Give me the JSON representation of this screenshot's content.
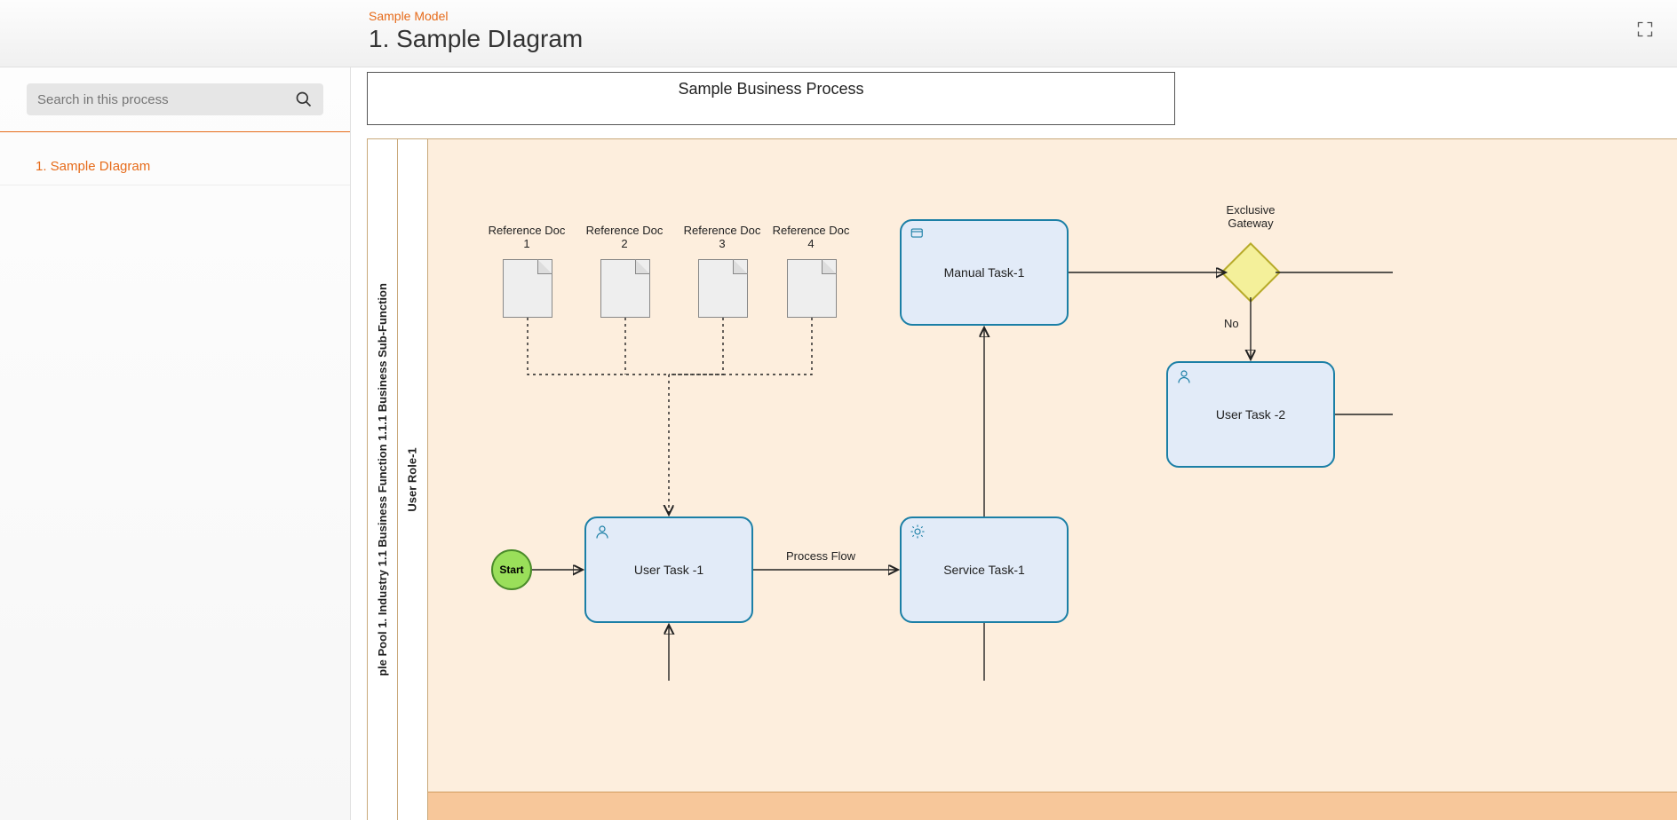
{
  "header": {
    "model_name": "Sample Model",
    "diagram_title": "1. Sample DIagram"
  },
  "sidebar": {
    "search_placeholder": "Search in this process",
    "items": [
      {
        "label": "1. Sample DIagram"
      }
    ]
  },
  "diagram": {
    "pool_header": "Sample Business Process",
    "pool_title": "ple Pool 1. Industry 1.1 Business Function 1.1.1 Business Sub-Function",
    "lane_title": "User Role-1",
    "docs": [
      {
        "label": "Reference Doc 1"
      },
      {
        "label": "Reference Doc 2"
      },
      {
        "label": "Reference Doc 3"
      },
      {
        "label": "Reference Doc 4"
      }
    ],
    "start_label": "Start",
    "tasks": {
      "user_task_1": "User Task -1",
      "service_task_1": "Service Task-1",
      "manual_task_1": "Manual Task-1",
      "user_task_2": "User Task -2"
    },
    "gateway_label": "Exclusive Gateway",
    "edge_labels": {
      "process_flow": "Process Flow",
      "no": "No"
    }
  }
}
